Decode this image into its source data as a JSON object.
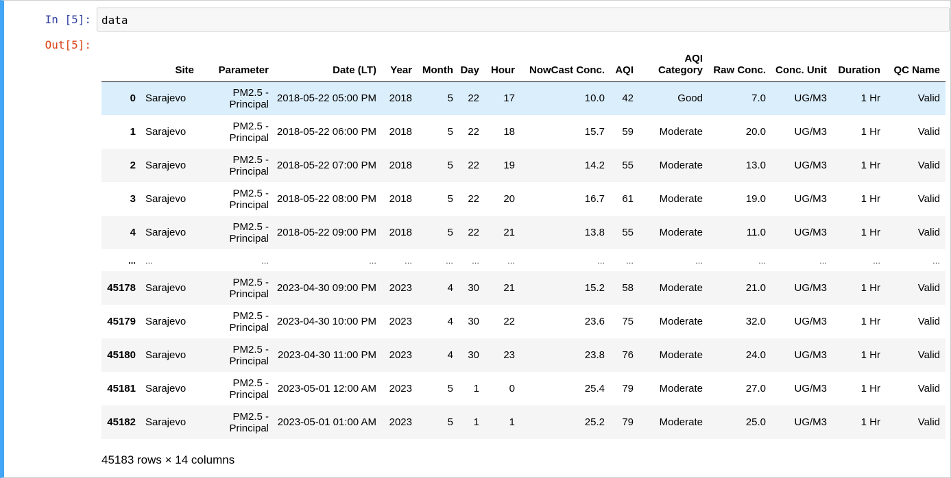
{
  "prompts": {
    "in": "In [5]:",
    "out": "Out[5]:"
  },
  "input_code": "data",
  "table": {
    "columns": [
      "",
      "Site",
      "Parameter",
      "Date (LT)",
      "Year",
      "Month",
      "Day",
      "Hour",
      "NowCast Conc.",
      "AQI",
      "AQI Category",
      "Raw Conc.",
      "Conc. Unit",
      "Duration",
      "QC Name"
    ],
    "rows": [
      [
        "0",
        "Sarajevo",
        "PM2.5 - Principal",
        "2018-05-22 05:00 PM",
        "2018",
        "5",
        "22",
        "17",
        "10.0",
        "42",
        "Good",
        "7.0",
        "UG/M3",
        "1 Hr",
        "Valid"
      ],
      [
        "1",
        "Sarajevo",
        "PM2.5 - Principal",
        "2018-05-22 06:00 PM",
        "2018",
        "5",
        "22",
        "18",
        "15.7",
        "59",
        "Moderate",
        "20.0",
        "UG/M3",
        "1 Hr",
        "Valid"
      ],
      [
        "2",
        "Sarajevo",
        "PM2.5 - Principal",
        "2018-05-22 07:00 PM",
        "2018",
        "5",
        "22",
        "19",
        "14.2",
        "55",
        "Moderate",
        "13.0",
        "UG/M3",
        "1 Hr",
        "Valid"
      ],
      [
        "3",
        "Sarajevo",
        "PM2.5 - Principal",
        "2018-05-22 08:00 PM",
        "2018",
        "5",
        "22",
        "20",
        "16.7",
        "61",
        "Moderate",
        "19.0",
        "UG/M3",
        "1 Hr",
        "Valid"
      ],
      [
        "4",
        "Sarajevo",
        "PM2.5 - Principal",
        "2018-05-22 09:00 PM",
        "2018",
        "5",
        "22",
        "21",
        "13.8",
        "55",
        "Moderate",
        "11.0",
        "UG/M3",
        "1 Hr",
        "Valid"
      ],
      [
        "...",
        "...",
        "...",
        "...",
        "...",
        "...",
        "...",
        "...",
        "...",
        "...",
        "...",
        "...",
        "...",
        "...",
        "..."
      ],
      [
        "45178",
        "Sarajevo",
        "PM2.5 - Principal",
        "2023-04-30 09:00 PM",
        "2023",
        "4",
        "30",
        "21",
        "15.2",
        "58",
        "Moderate",
        "21.0",
        "UG/M3",
        "1 Hr",
        "Valid"
      ],
      [
        "45179",
        "Sarajevo",
        "PM2.5 - Principal",
        "2023-04-30 10:00 PM",
        "2023",
        "4",
        "30",
        "22",
        "23.6",
        "75",
        "Moderate",
        "32.0",
        "UG/M3",
        "1 Hr",
        "Valid"
      ],
      [
        "45180",
        "Sarajevo",
        "PM2.5 - Principal",
        "2023-04-30 11:00 PM",
        "2023",
        "4",
        "30",
        "23",
        "23.8",
        "76",
        "Moderate",
        "24.0",
        "UG/M3",
        "1 Hr",
        "Valid"
      ],
      [
        "45181",
        "Sarajevo",
        "PM2.5 - Principal",
        "2023-05-01 12:00 AM",
        "2023",
        "5",
        "1",
        "0",
        "25.4",
        "79",
        "Moderate",
        "27.0",
        "UG/M3",
        "1 Hr",
        "Valid"
      ],
      [
        "45182",
        "Sarajevo",
        "PM2.5 - Principal",
        "2023-05-01 01:00 AM",
        "2023",
        "5",
        "1",
        "1",
        "25.2",
        "79",
        "Moderate",
        "25.0",
        "UG/M3",
        "1 Hr",
        "Valid"
      ]
    ]
  },
  "shape_text": "45183 rows × 14 columns"
}
